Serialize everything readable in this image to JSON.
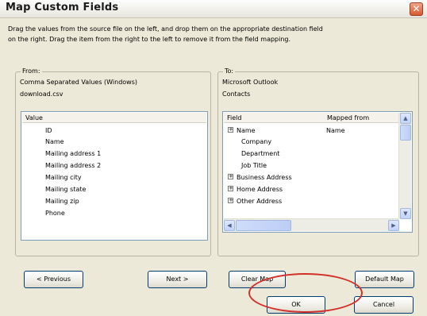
{
  "window": {
    "title": "Map Custom Fields",
    "close_icon": "close-icon"
  },
  "instructions": {
    "line1": "Drag the values from the source file on the left, and drop them on the appropriate destination field",
    "line2": "on the right.  Drag the item from the right to the left to remove it from the field mapping."
  },
  "from": {
    "group_label": "From:",
    "source_type": "Comma Separated Values (Windows)",
    "source_file": "download.csv",
    "column_header": "Value",
    "items": [
      "ID",
      "Name",
      "Mailing address 1",
      "Mailing address 2",
      "Mailing city",
      "Mailing state",
      "Mailing zip",
      "Phone"
    ],
    "prev_button": "< Previous",
    "next_button": "Next >"
  },
  "to": {
    "group_label": "To:",
    "dest_app": "Microsoft Outlook",
    "dest_folder": "Contacts",
    "col_field": "Field",
    "col_mapped": "Mapped from",
    "rows": [
      {
        "field": "Name",
        "mapped": "Name",
        "expand": "+"
      },
      {
        "field": "Company",
        "mapped": "",
        "expand": ""
      },
      {
        "field": "Department",
        "mapped": "",
        "expand": ""
      },
      {
        "field": "Job Title",
        "mapped": "",
        "expand": ""
      },
      {
        "field": "Business Address",
        "mapped": "",
        "expand": "+"
      },
      {
        "field": "Home Address",
        "mapped": "",
        "expand": "+"
      },
      {
        "field": "Other Address",
        "mapped": "",
        "expand": "+"
      }
    ],
    "clear_button": "Clear Map",
    "default_button": "Default Map"
  },
  "footer": {
    "ok_button": "OK",
    "cancel_button": "Cancel",
    "highlight_color": "#d3302a"
  }
}
